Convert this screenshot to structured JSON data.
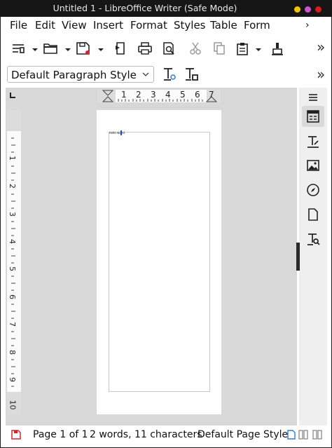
{
  "window": {
    "title": "Untitled 1 - LibreOffice Writer (Safe Mode)",
    "controls": [
      {
        "name": "minimize",
        "color": "#f5c400"
      },
      {
        "name": "maximize",
        "color": "#d14fd6"
      },
      {
        "name": "close",
        "color": "#d01e1e"
      }
    ]
  },
  "menubar": {
    "items": [
      "File",
      "Edit",
      "View",
      "Insert",
      "Format",
      "Styles",
      "Table",
      "Form"
    ],
    "more": "›"
  },
  "toolbar": {
    "more": "»",
    "icons": [
      "new-document-icon",
      "open-icon",
      "save-icon",
      "export-pdf-icon",
      "print-icon",
      "print-preview-icon",
      "cut-icon",
      "copy-icon",
      "paste-icon",
      "clone-formatting-icon"
    ]
  },
  "format_bar": {
    "paragraph_style": "Default Paragraph Style",
    "more": "»"
  },
  "ruler": {
    "h_ticks": [
      "1",
      "2",
      "3",
      "4",
      "5",
      "6",
      "7"
    ],
    "v_ticks": [
      "1",
      "2",
      "3",
      "4",
      "5",
      "6",
      "7",
      "8",
      "9",
      "10"
    ]
  },
  "document": {
    "text": "hello world"
  },
  "statusbar": {
    "page": "Page 1 of 1",
    "words": "2 words, 11 characters",
    "page_style": "Default Page Style"
  }
}
